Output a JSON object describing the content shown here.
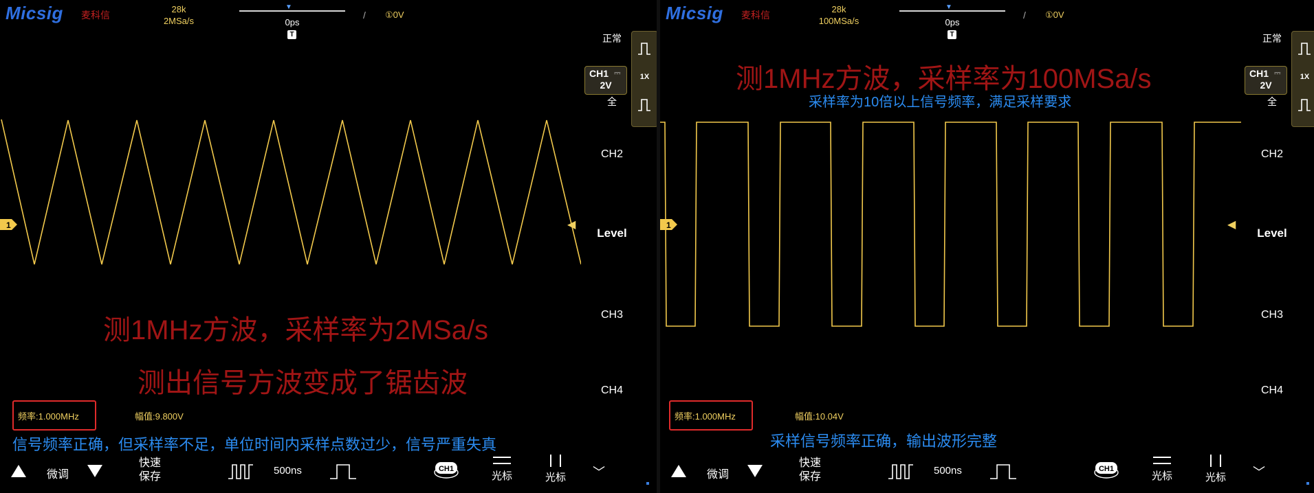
{
  "colors": {
    "trace": "#f2c94c",
    "accent": "#f0d060",
    "banner_red": "#a01515",
    "note_blue": "#2b8bf0",
    "highlight_box": "#e02b2b"
  },
  "left": {
    "logo": "Micsig",
    "logo_cn": "麦科信",
    "memory_depth": "28k",
    "sample_rate": "2MSa/s",
    "delay": "0ps",
    "trigger_icon": "T",
    "trigger_slash": "/",
    "trigger_level": "①0V",
    "banner_title": "测1MHz方波，采样率为2MSa/s",
    "banner_sub": "测出信号方波变成了锯齿波",
    "freq_measure": "频率:1.000MHz",
    "amp_measure": "幅值:9.800V",
    "note": "信号频率正确，但采样率不足，单位时间内采样点数过少，信号严重失真",
    "channel_marker": "1",
    "waveform": "triangle"
  },
  "right": {
    "logo": "Micsig",
    "logo_cn": "麦科信",
    "memory_depth": "28k",
    "sample_rate": "100MSa/s",
    "delay": "0ps",
    "trigger_icon": "T",
    "trigger_slash": "/",
    "trigger_level": "①0V",
    "banner_title": "测1MHz方波，采样率为100MSa/s",
    "banner_blue": "采样率为10倍以上信号频率，满足采样要求",
    "freq_measure": "频率:1.000MHz",
    "amp_measure": "幅值:10.04V",
    "note": "采样信号频率正确，输出波形完整",
    "channel_marker": "1",
    "waveform": "square"
  },
  "side": {
    "mode": "正常",
    "ch1_name": "CH1",
    "ch1_coupling": "⎓",
    "ch1_scale": "2V",
    "bandwidth": "全",
    "probe": "1X",
    "ch2": "CH2",
    "level": "Level",
    "ch3": "CH3",
    "ch4": "CH4"
  },
  "bottom": {
    "fine_adjust": "微调",
    "quick_save_1": "快速",
    "quick_save_2": "保存",
    "timebase": "500ns",
    "ch1_pill": "CH1",
    "cursor1": "光标",
    "cursor2": "光标",
    "more_icon": "chevron-down-icon"
  }
}
